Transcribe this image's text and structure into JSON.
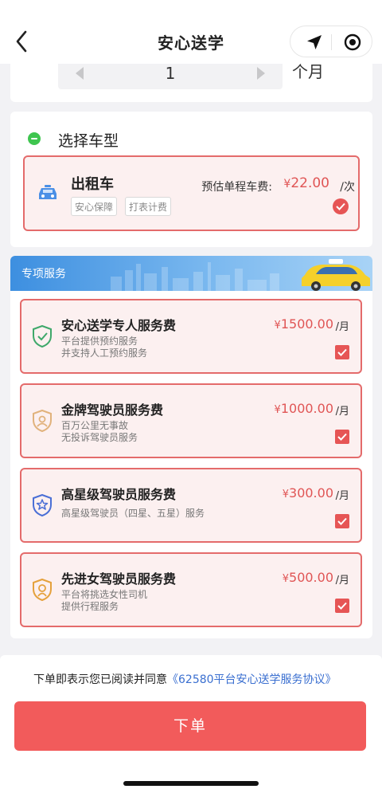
{
  "nav": {
    "title": "安心送学"
  },
  "duration": {
    "value": "1",
    "unit": "个月"
  },
  "car_section": {
    "title": "选择车型",
    "option": {
      "name": "出租车",
      "tags": [
        "安心保障",
        "打表计费"
      ],
      "fare_label": "预估单程车费:",
      "currency": "¥",
      "fare": "22.00",
      "per": "/次"
    }
  },
  "services": {
    "title": "专项服务",
    "items": [
      {
        "name": "安心送学专人服务费",
        "desc": [
          "平台提供预约服务",
          "并支持人工预约服务"
        ],
        "currency": "¥",
        "price": "1500.00",
        "per": "/月",
        "icon": "shield-check-icon",
        "icon_color": "#3ea86a"
      },
      {
        "name": "金牌驾驶员服务费",
        "desc": [
          "百万公里无事故",
          "无投诉驾驶员服务"
        ],
        "currency": "¥",
        "price": "1000.00",
        "per": "/月",
        "icon": "shield-driver-icon",
        "icon_color": "#e1b27c"
      },
      {
        "name": "高星级驾驶员服务费",
        "desc": [
          "高星级驾驶员（四星、五星）服务"
        ],
        "currency": "¥",
        "price": "300.00",
        "per": "/月",
        "icon": "shield-star-icon",
        "icon_color": "#4a6fd6"
      },
      {
        "name": "先进女驾驶员服务费",
        "desc": [
          "平台将挑选女性司机",
          "提供行程服务"
        ],
        "currency": "¥",
        "price": "500.00",
        "per": "/月",
        "icon": "shield-female-icon",
        "icon_color": "#e5a13c"
      }
    ]
  },
  "footer": {
    "agree_text": "下单即表示您已阅读并同意",
    "agreement_link": "《62580平台安心送学服务协议》",
    "order_button": "下单"
  },
  "colors": {
    "accent": "#e65555",
    "link": "#3a6fd0",
    "check_green": "#3ec54f"
  }
}
